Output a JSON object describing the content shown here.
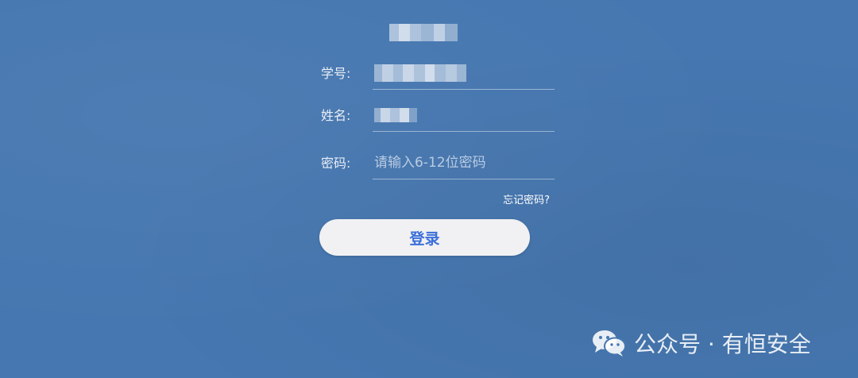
{
  "form": {
    "student_id": {
      "label": "学号:",
      "value": ""
    },
    "name": {
      "label": "姓名:",
      "value": ""
    },
    "password": {
      "label": "密码:",
      "placeholder": "请输入6-12位密码",
      "value": ""
    },
    "forgot_label": "忘记密码?",
    "login_label": "登录"
  },
  "watermark": {
    "text": "公众号 · 有恒安全",
    "icon": "wechat-icon"
  },
  "colors": {
    "background": "#4677b0",
    "button_bg": "#f1f1f3",
    "button_text": "#3a6fd9"
  }
}
